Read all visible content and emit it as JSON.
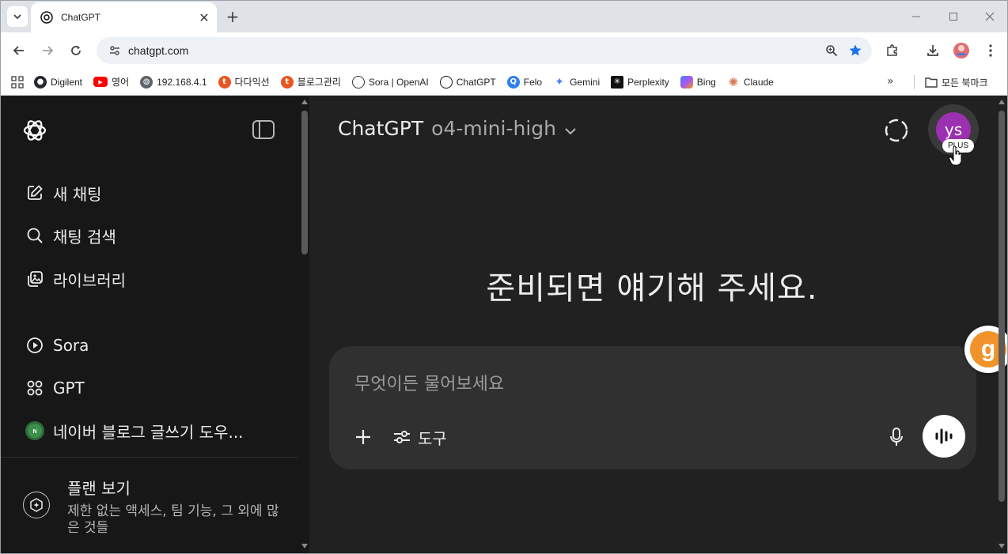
{
  "browser": {
    "tab": {
      "title": "ChatGPT"
    },
    "address": {
      "url": "chatgpt.com"
    },
    "bookmarks": [
      {
        "label": "Digilent",
        "icon": "github-icon"
      },
      {
        "label": "영어",
        "icon": "youtube-icon"
      },
      {
        "label": "192.168.4.1",
        "icon": "globe-icon"
      },
      {
        "label": "다다익선",
        "icon": "tistory-icon"
      },
      {
        "label": "블로그관리",
        "icon": "tistory-icon"
      },
      {
        "label": "Sora | OpenAI",
        "icon": "openai-icon"
      },
      {
        "label": "ChatGPT",
        "icon": "openai-icon"
      },
      {
        "label": "Felo",
        "icon": "felo-icon"
      },
      {
        "label": "Gemini",
        "icon": "gemini-icon"
      },
      {
        "label": "Perplexity",
        "icon": "perplexity-icon"
      },
      {
        "label": "Bing",
        "icon": "copilot-icon"
      },
      {
        "label": "Claude",
        "icon": "claude-icon"
      }
    ],
    "all_bookmarks_label": "모든 북마크",
    "more_label": "»"
  },
  "sidebar": {
    "items": [
      {
        "label": "새 채팅",
        "icon": "edit-icon"
      },
      {
        "label": "채팅 검색",
        "icon": "search-icon"
      },
      {
        "label": "라이브러리",
        "icon": "library-icon"
      },
      {
        "label": "Sora",
        "icon": "play-icon"
      },
      {
        "label": "GPT",
        "icon": "grid-icon"
      },
      {
        "label": "네이버 블로그 글쓰기 도우...",
        "icon": "naver-gpt-avatar"
      }
    ],
    "plan": {
      "title": "플랜 보기",
      "description": "제한 없는 액세스, 팀 기능, 그 외에 많은 것들"
    }
  },
  "main": {
    "model_name": "ChatGPT",
    "model_variant": "o4-mini-high",
    "avatar_initials": "ys",
    "plan_badge": "PLUS",
    "headline": "준비되면 얘기해 주세요.",
    "composer": {
      "placeholder": "무엇이든 물어보세요",
      "tools_label": "도구"
    },
    "floating_widget_letter": "g"
  },
  "colors": {
    "sidebar_bg": "#171717",
    "main_bg": "#212121",
    "composer_bg": "#303030",
    "avatar_bg": "#9b30b0",
    "bookmark_star": "#1a73e8"
  }
}
